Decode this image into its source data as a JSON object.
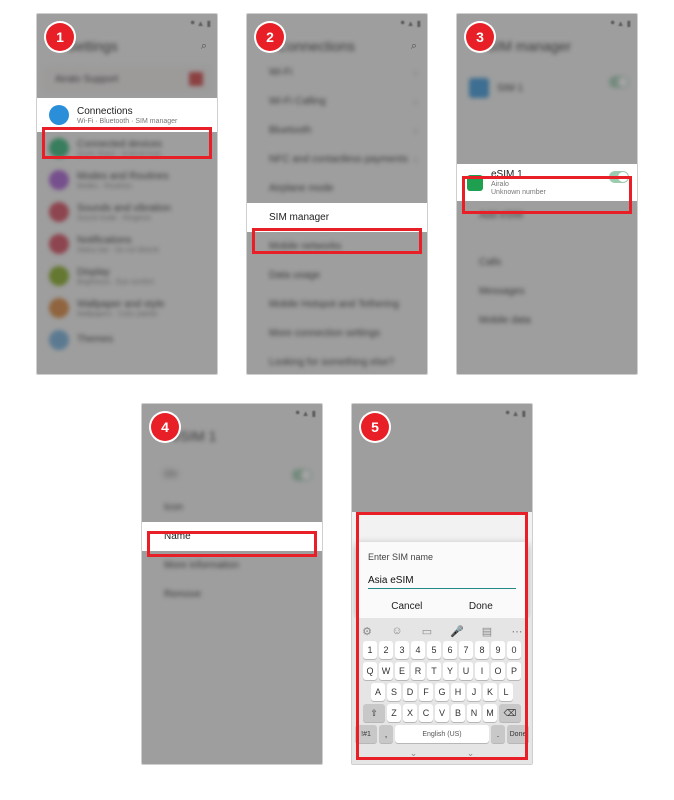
{
  "badges": [
    "1",
    "2",
    "3",
    "4",
    "5"
  ],
  "screen1": {
    "title_blur": "Settings",
    "connections": {
      "title": "Connections",
      "sub": "Wi-Fi · Bluetooth · SIM manager"
    },
    "blur_items": [
      {
        "color": "#1fae6c",
        "t": "Connected devices",
        "s": "Quick Share · Android Auto"
      },
      {
        "color": "#a04fcf",
        "t": "Modes and Routines",
        "s": "Modes · Routines"
      },
      {
        "color": "#d03a4e",
        "t": "Sounds and vibration",
        "s": "Sound mode · Ringtone"
      },
      {
        "color": "#d03a4e",
        "t": "Notifications",
        "s": "Status bar · Do not disturb"
      },
      {
        "color": "#7ba30f",
        "t": "Display",
        "s": "Brightness · Eye comfort"
      },
      {
        "color": "#d67a2a",
        "t": "Wallpaper and style",
        "s": "Wallpapers · Color palette"
      },
      {
        "color": "#68a8d8",
        "t": "Themes",
        "s": ""
      }
    ]
  },
  "screen2": {
    "title_blur": "Connections",
    "sim_manager": "SIM manager",
    "blur_items_top": [
      "Wi-Fi",
      "Wi-Fi Calling",
      "Bluetooth",
      "NFC and contactless payments",
      "Airplane mode"
    ],
    "blur_items_bot": [
      "Mobile networks",
      "Data usage",
      "Mobile Hotspot and Tethering",
      "More connection settings",
      "Looking for something else?"
    ]
  },
  "screen3": {
    "title_blur": "SIM manager",
    "sim1": "SIM 1",
    "esim": {
      "title": "eSIM 1",
      "sub1": "Airalo",
      "sub2": "Unknown number"
    },
    "blur_rows": [
      "Add eSIM",
      "",
      "Calls",
      "Messages",
      "Mobile data"
    ]
  },
  "screen4": {
    "title_blur": "eSIM 1",
    "name": "Name",
    "blur_rows": [
      "On",
      "Icon",
      "More information",
      "Remove"
    ]
  },
  "screen5": {
    "dialog": {
      "label": "Enter SIM name",
      "value": "Asia eSIM",
      "cancel": "Cancel",
      "done": "Done"
    },
    "space_label": "English (US)",
    "done_key": "Done",
    "keys_r1": [
      "1",
      "2",
      "3",
      "4",
      "5",
      "6",
      "7",
      "8",
      "9",
      "0"
    ],
    "keys_r2": [
      "Q",
      "W",
      "E",
      "R",
      "T",
      "Y",
      "U",
      "I",
      "O",
      "P"
    ],
    "keys_r3": [
      "A",
      "S",
      "D",
      "F",
      "G",
      "H",
      "J",
      "K",
      "L"
    ],
    "keys_r4": [
      "Z",
      "X",
      "C",
      "V",
      "B",
      "N",
      "M"
    ]
  }
}
